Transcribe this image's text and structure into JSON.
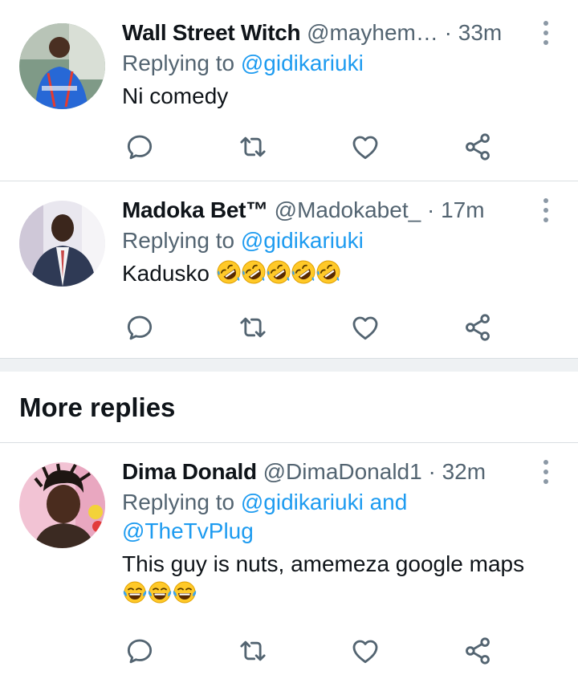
{
  "tweets": [
    {
      "name": "Wall Street Witch",
      "handle": "@mayhem…",
      "time": "· 33m",
      "replying_prefix": "Replying to ",
      "mentions": "@gidikariuki",
      "mentions_line2": "",
      "text": "Ni comedy",
      "emojis": ""
    },
    {
      "name": "Madoka Bet™",
      "handle": "@Madokabet_",
      "time": "· 17m",
      "replying_prefix": "Replying to ",
      "mentions": "@gidikariuki",
      "mentions_line2": "",
      "text": "Kadusko",
      "emojis": "🤣🤣🤣🤣🤣"
    },
    {
      "name": "Dima Donald",
      "handle": "@DimaDonald1",
      "time": "· 32m",
      "replying_prefix": "Replying to ",
      "mentions": "@gidikariuki and",
      "mentions_line2": "@TheTvPlug",
      "text": "This guy is nuts, amemeza google maps",
      "emojis": "😂😂😂"
    }
  ],
  "section": {
    "more_replies": "More replies"
  },
  "icons": {
    "reply": "reply-icon",
    "retweet": "retweet-icon",
    "like": "like-icon",
    "share": "share-icon",
    "more": "more-icon"
  },
  "colors": {
    "mention": "#1d9bf0",
    "secondary": "#536471",
    "icon": "#536471"
  }
}
